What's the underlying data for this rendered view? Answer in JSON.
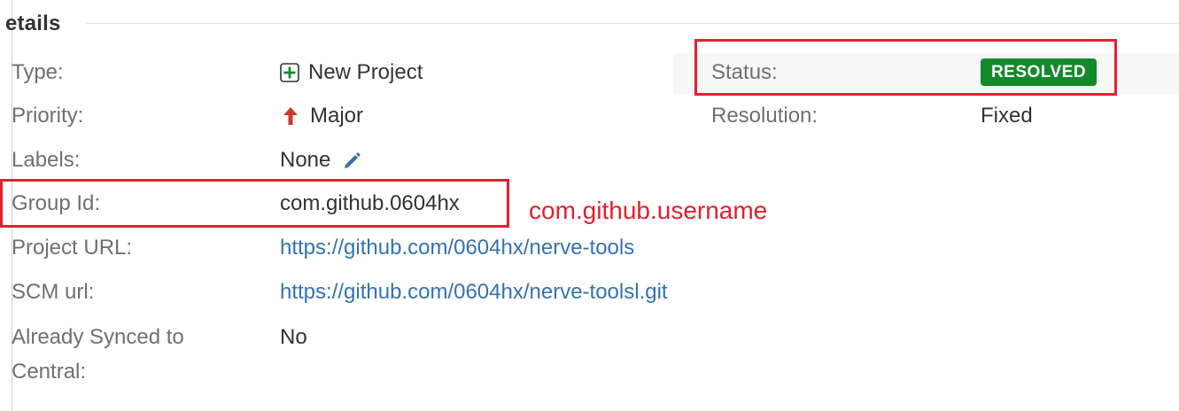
{
  "section": {
    "title": "etails"
  },
  "details": {
    "type": {
      "label": "Type:",
      "value": "New Project",
      "icon": "plus-square-icon"
    },
    "priority": {
      "label": "Priority:",
      "value": "Major",
      "icon": "arrow-up-icon"
    },
    "labels": {
      "label": "Labels:",
      "value": "None",
      "icon": "pencil-icon"
    },
    "group_id": {
      "label": "Group Id:",
      "value": "com.github.0604hx"
    },
    "project_url": {
      "label": "Project URL:",
      "value": "https://github.com/0604hx/nerve-tools"
    },
    "scm_url": {
      "label": "SCM url:",
      "value": "https://github.com/0604hx/nerve-toolsl.git"
    },
    "synced": {
      "label_line1": "Already Synced to",
      "label_line2": "Central:",
      "value": "No"
    },
    "status": {
      "label": "Status:",
      "value": "RESOLVED"
    },
    "resolution": {
      "label": "Resolution:",
      "value": "Fixed"
    }
  },
  "annotation": {
    "text": "com.github.username"
  },
  "colors": {
    "label": "#707070",
    "value": "#333333",
    "link": "#3572b0",
    "status_green": "#14892c",
    "priority_red": "#cc3a2b",
    "icon_green": "#14892c",
    "highlight_red": "#e3202f"
  }
}
